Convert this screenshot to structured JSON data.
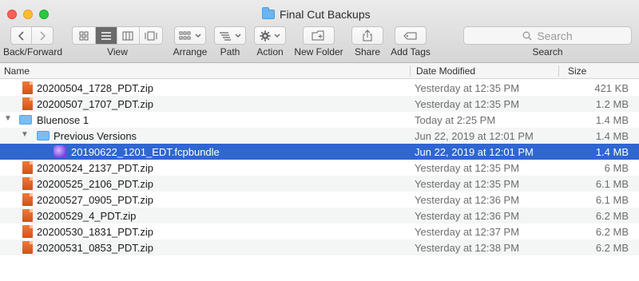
{
  "window": {
    "title": "Final Cut Backups"
  },
  "toolbar": {
    "back_forward_label": "Back/Forward",
    "view_label": "View",
    "arrange_label": "Arrange",
    "path_label": "Path",
    "action_label": "Action",
    "new_folder_label": "New Folder",
    "share_label": "Share",
    "add_tags_label": "Add Tags",
    "search_label": "Search",
    "search_placeholder": "Search"
  },
  "columns": {
    "name": "Name",
    "date": "Date Modified",
    "size": "Size"
  },
  "rows": [
    {
      "name": "20200504_1728_PDT.zip",
      "date": "Yesterday at 12:35 PM",
      "size": "421 KB"
    },
    {
      "name": "20200507_1707_PDT.zip",
      "date": "Yesterday at 12:35 PM",
      "size": "1.2 MB"
    },
    {
      "name": "Bluenose 1",
      "date": "Today at 2:25 PM",
      "size": "1.4 MB"
    },
    {
      "name": "Previous Versions",
      "date": "Jun 22, 2019 at 12:01 PM",
      "size": "1.4 MB"
    },
    {
      "name": "20190622_1201_EDT.fcpbundle",
      "date": "Jun 22, 2019 at 12:01 PM",
      "size": "1.4 MB"
    },
    {
      "name": "20200524_2137_PDT.zip",
      "date": "Yesterday at 12:35 PM",
      "size": "6 MB"
    },
    {
      "name": "20200525_2106_PDT.zip",
      "date": "Yesterday at 12:35 PM",
      "size": "6.1 MB"
    },
    {
      "name": "20200527_0905_PDT.zip",
      "date": "Yesterday at 12:36 PM",
      "size": "6.1 MB"
    },
    {
      "name": "20200529_4_PDT.zip",
      "date": "Yesterday at 12:36 PM",
      "size": "6.2 MB"
    },
    {
      "name": "20200530_1831_PDT.zip",
      "date": "Yesterday at 12:37 PM",
      "size": "6.2 MB"
    },
    {
      "name": "20200531_0853_PDT.zip",
      "date": "Yesterday at 12:38 PM",
      "size": "6.2 MB"
    }
  ],
  "colors": {
    "selection": "#2f66d0",
    "zip": "#e0602a",
    "folder": "#79bdf5"
  }
}
